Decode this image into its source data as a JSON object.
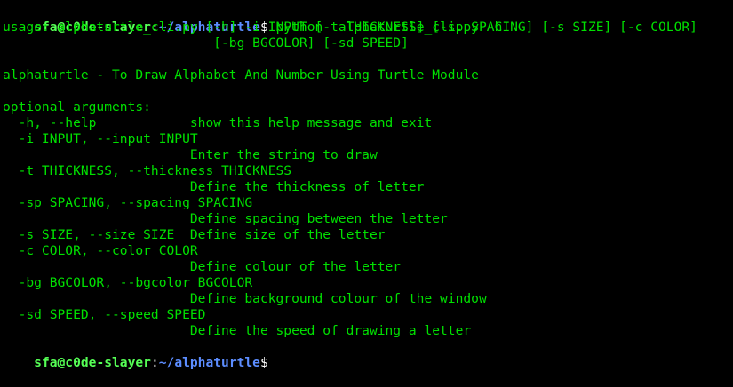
{
  "prompt1": {
    "user_host": "sfa@c0de-slayer",
    "sep": ":",
    "path": "~/alphaturtle",
    "symbol": "$",
    "command": " python  alphaturtle_cli.py -h"
  },
  "usage": {
    "line1": "usage: alphaturtle_cli.py [-h] -i INPUT [-t THICKNESS] [-sp SPACING] [-s SIZE] [-c COLOR]",
    "line2": "                           [-bg BGCOLOR] [-sd SPEED]"
  },
  "description": "alphaturtle - To Draw Alphabet And Number Using Turtle Module",
  "options_header": "optional arguments:",
  "options": [
    "  -h, --help            show this help message and exit",
    "  -i INPUT, --input INPUT",
    "                        Enter the string to draw",
    "  -t THICKNESS, --thickness THICKNESS",
    "                        Define the thickness of letter",
    "  -sp SPACING, --spacing SPACING",
    "                        Define spacing between the letter",
    "  -s SIZE, --size SIZE  Define size of the letter",
    "  -c COLOR, --color COLOR",
    "                        Define colour of the letter",
    "  -bg BGCOLOR, --bgcolor BGCOLOR",
    "                        Define background colour of the window",
    "  -sd SPEED, --speed SPEED",
    "                        Define the speed of drawing a letter"
  ],
  "prompt2": {
    "user_host": "sfa@c0de-slayer",
    "sep": ":",
    "path": "~/alphaturtle",
    "symbol": "$"
  },
  "colors": {
    "background": "#000000",
    "text": "#00e000",
    "user_host": "#55ff55",
    "path": "#5c8dff",
    "symbol": "#ffffff"
  }
}
